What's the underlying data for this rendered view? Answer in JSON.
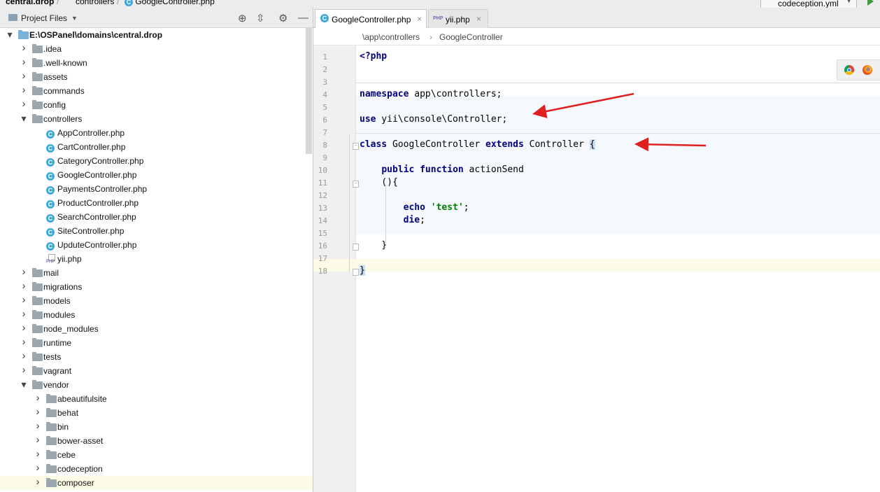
{
  "top_breadcrumb": [
    "central.drop",
    "controllers",
    "GoogleController.php"
  ],
  "run_config": {
    "label": "codeception.yml"
  },
  "project_panel": {
    "title": "Project Files"
  },
  "tree": [
    {
      "label": "E:\\OSPanel\\domains\\central.drop",
      "depth": 0,
      "arrow": "down",
      "icon": "folder-blue",
      "bold": true
    },
    {
      "label": ".idea",
      "depth": 1,
      "arrow": "right",
      "icon": "folder"
    },
    {
      "label": ".well-known",
      "depth": 1,
      "arrow": "right",
      "icon": "folder"
    },
    {
      "label": "assets",
      "depth": 1,
      "arrow": "right",
      "icon": "folder"
    },
    {
      "label": "commands",
      "depth": 1,
      "arrow": "right",
      "icon": "folder"
    },
    {
      "label": "config",
      "depth": 1,
      "arrow": "right",
      "icon": "folder"
    },
    {
      "label": "controllers",
      "depth": 1,
      "arrow": "down",
      "icon": "folder"
    },
    {
      "label": "AppController.php",
      "depth": 2,
      "icon": "class"
    },
    {
      "label": "CartController.php",
      "depth": 2,
      "icon": "class"
    },
    {
      "label": "CategoryController.php",
      "depth": 2,
      "icon": "class"
    },
    {
      "label": "GoogleController.php",
      "depth": 2,
      "icon": "class"
    },
    {
      "label": "PaymentsController.php",
      "depth": 2,
      "icon": "class"
    },
    {
      "label": "ProductController.php",
      "depth": 2,
      "icon": "class"
    },
    {
      "label": "SearchController.php",
      "depth": 2,
      "icon": "class"
    },
    {
      "label": "SiteController.php",
      "depth": 2,
      "icon": "class"
    },
    {
      "label": "UpduteController.php",
      "depth": 2,
      "icon": "class"
    },
    {
      "label": "yii.php",
      "depth": 2,
      "icon": "php"
    },
    {
      "label": "mail",
      "depth": 1,
      "arrow": "right",
      "icon": "folder"
    },
    {
      "label": "migrations",
      "depth": 1,
      "arrow": "right",
      "icon": "folder"
    },
    {
      "label": "models",
      "depth": 1,
      "arrow": "right",
      "icon": "folder"
    },
    {
      "label": "modules",
      "depth": 1,
      "arrow": "right",
      "icon": "folder"
    },
    {
      "label": "node_modules",
      "depth": 1,
      "arrow": "right",
      "icon": "folder"
    },
    {
      "label": "runtime",
      "depth": 1,
      "arrow": "right",
      "icon": "folder"
    },
    {
      "label": "tests",
      "depth": 1,
      "arrow": "right",
      "icon": "folder"
    },
    {
      "label": "vagrant",
      "depth": 1,
      "arrow": "right",
      "icon": "folder"
    },
    {
      "label": "vendor",
      "depth": 1,
      "arrow": "down",
      "icon": "folder"
    },
    {
      "label": "abeautifulsite",
      "depth": 2,
      "arrow": "right",
      "icon": "folder"
    },
    {
      "label": "behat",
      "depth": 2,
      "arrow": "right",
      "icon": "folder"
    },
    {
      "label": "bin",
      "depth": 2,
      "arrow": "right",
      "icon": "folder"
    },
    {
      "label": "bower-asset",
      "depth": 2,
      "arrow": "right",
      "icon": "folder"
    },
    {
      "label": "cebe",
      "depth": 2,
      "arrow": "right",
      "icon": "folder"
    },
    {
      "label": "codeception",
      "depth": 2,
      "arrow": "right",
      "icon": "folder"
    },
    {
      "label": "composer",
      "depth": 2,
      "arrow": "right",
      "icon": "folder",
      "selected": true
    }
  ],
  "tabs": [
    {
      "label": "GoogleController.php",
      "icon": "class",
      "active": true
    },
    {
      "label": "yii.php",
      "icon": "php",
      "active": false
    }
  ],
  "breadcrumb": [
    "\\app\\controllers",
    "GoogleController"
  ],
  "code_lines": [
    "<?php",
    "",
    "",
    "namespace app\\controllers;",
    "",
    "use yii\\console\\Controller;",
    "",
    "class GoogleController extends Controller {",
    "",
    "    public function actionSend",
    "    (){",
    "",
    "        echo 'test';",
    "        die;",
    "",
    "    }",
    "",
    "}"
  ],
  "colors": {
    "keyword": "#000080",
    "string": "#008000",
    "annotation_arrow": "#e02020"
  }
}
